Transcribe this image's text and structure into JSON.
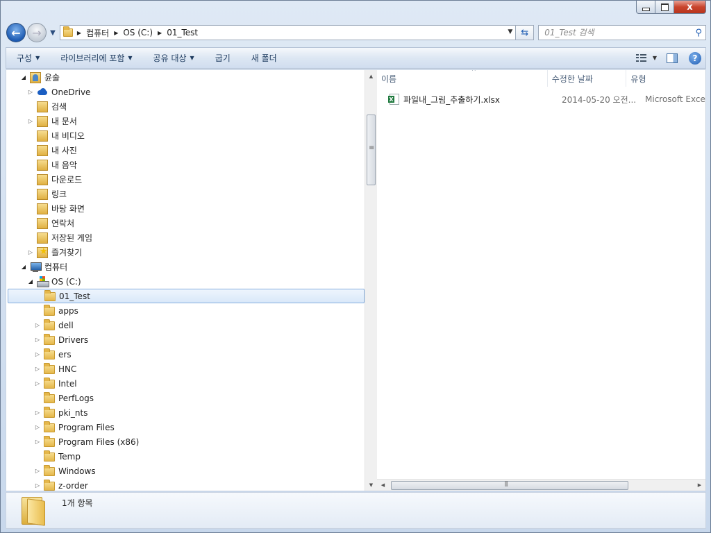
{
  "window": {
    "caption": {
      "close_label": "x"
    }
  },
  "nav": {
    "back_glyph": "←",
    "forward_glyph": "→",
    "address": {
      "crumbs": [
        "컴퓨터",
        "OS (C:)",
        "01_Test"
      ]
    },
    "search_placeholder": "01_Test 검색"
  },
  "commandbar": {
    "items": [
      {
        "label": "구성",
        "dropdown": true
      },
      {
        "label": "라이브러리에 포함",
        "dropdown": true
      },
      {
        "label": "공유 대상",
        "dropdown": true
      },
      {
        "label": "굽기",
        "dropdown": false
      },
      {
        "label": "새 폴더",
        "dropdown": false
      }
    ],
    "help_label": "?"
  },
  "tree": {
    "items": [
      {
        "label": "윤술",
        "level": 1,
        "expander": "open",
        "icon": "user-icon"
      },
      {
        "label": "OneDrive",
        "level": 2,
        "expander": "closed",
        "icon": "cloud-icon"
      },
      {
        "label": "검색",
        "level": 2,
        "expander": "none",
        "icon": "lib-icon"
      },
      {
        "label": "내 문서",
        "level": 2,
        "expander": "closed",
        "icon": "lib-icon"
      },
      {
        "label": "내 비디오",
        "level": 2,
        "expander": "none",
        "icon": "lib-icon"
      },
      {
        "label": "내 사진",
        "level": 2,
        "expander": "none",
        "icon": "lib-icon"
      },
      {
        "label": "내 음악",
        "level": 2,
        "expander": "none",
        "icon": "lib-icon"
      },
      {
        "label": "다운로드",
        "level": 2,
        "expander": "none",
        "icon": "lib-icon"
      },
      {
        "label": "링크",
        "level": 2,
        "expander": "none",
        "icon": "lib-icon"
      },
      {
        "label": "바탕 화면",
        "level": 2,
        "expander": "none",
        "icon": "lib-icon"
      },
      {
        "label": "연락처",
        "level": 2,
        "expander": "none",
        "icon": "lib-icon"
      },
      {
        "label": "저장된 게임",
        "level": 2,
        "expander": "none",
        "icon": "lib-icon"
      },
      {
        "label": "즐겨찾기",
        "level": 2,
        "expander": "closed",
        "icon": "star-icon"
      },
      {
        "label": "컴퓨터",
        "level": 1,
        "expander": "open",
        "icon": "pc-icon"
      },
      {
        "label": "OS (C:)",
        "level": 2,
        "expander": "open",
        "icon": "drive-icon"
      },
      {
        "label": "01_Test",
        "level": 3,
        "expander": "none",
        "icon": "folder-icon",
        "selected": true
      },
      {
        "label": "apps",
        "level": 3,
        "expander": "none",
        "icon": "folder-icon"
      },
      {
        "label": "dell",
        "level": 3,
        "expander": "closed",
        "icon": "folder-icon"
      },
      {
        "label": "Drivers",
        "level": 3,
        "expander": "closed",
        "icon": "folder-icon"
      },
      {
        "label": "ers",
        "level": 3,
        "expander": "closed",
        "icon": "folder-icon"
      },
      {
        "label": "HNC",
        "level": 3,
        "expander": "closed",
        "icon": "folder-icon"
      },
      {
        "label": "Intel",
        "level": 3,
        "expander": "closed",
        "icon": "folder-icon"
      },
      {
        "label": "PerfLogs",
        "level": 3,
        "expander": "none",
        "icon": "folder-icon"
      },
      {
        "label": "pki_nts",
        "level": 3,
        "expander": "closed",
        "icon": "folder-icon"
      },
      {
        "label": "Program Files",
        "level": 3,
        "expander": "closed",
        "icon": "folder-icon"
      },
      {
        "label": "Program Files (x86)",
        "level": 3,
        "expander": "closed",
        "icon": "folder-icon"
      },
      {
        "label": "Temp",
        "level": 3,
        "expander": "none",
        "icon": "folder-icon"
      },
      {
        "label": "Windows",
        "level": 3,
        "expander": "closed",
        "icon": "folder-icon"
      },
      {
        "label": "z-order",
        "level": 3,
        "expander": "closed",
        "icon": "folder-icon"
      }
    ]
  },
  "files": {
    "columns": {
      "name": "이름",
      "date": "수정한 날짜",
      "type": "유형"
    },
    "rows": [
      {
        "name": "파일내_그림_추출하기.xlsx",
        "date": "2014-05-20 오전...",
        "type": "Microsoft Exce",
        "icon": "excel-file-icon"
      }
    ]
  },
  "details": {
    "count": "1개 항목"
  }
}
